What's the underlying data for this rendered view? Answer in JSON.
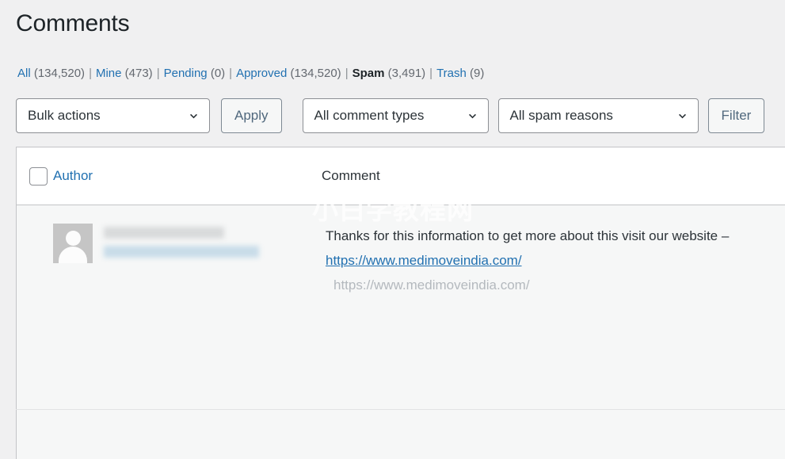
{
  "page": {
    "title": "Comments"
  },
  "filters": {
    "items": [
      {
        "label": "All",
        "count": "(134,520)",
        "current": false
      },
      {
        "label": "Mine",
        "count": "(473)",
        "current": false
      },
      {
        "label": "Pending",
        "count": "(0)",
        "current": false
      },
      {
        "label": "Approved",
        "count": "(134,520)",
        "current": false
      },
      {
        "label": "Spam",
        "count": "(3,491)",
        "current": true
      },
      {
        "label": "Trash",
        "count": "(9)",
        "current": false
      }
    ],
    "separator": "|"
  },
  "toolbar": {
    "bulk_actions_value": "Bulk actions",
    "apply_label": "Apply",
    "comment_types_value": "All comment types",
    "spam_reasons_value": "All spam reasons",
    "filter_label": "Filter"
  },
  "table": {
    "columns": {
      "author": "Author",
      "comment": "Comment"
    },
    "rows": [
      {
        "author_name_redacted": true,
        "author_email_redacted": true,
        "comment_text_before_link": "Thanks for this information to get more about this visit our website – ",
        "comment_link_text": "https://www.medimoveindia.com/",
        "comment_author_url": "https://www.medimoveindia.com/"
      }
    ]
  },
  "watermark": {
    "text": "小白学教程网"
  },
  "colors": {
    "page_background": "#f0f0f1",
    "link_blue": "#2271b1",
    "text_dark": "#1d2327",
    "text_muted": "#646970",
    "button_border": "#7e8993",
    "row_background": "#f6f7f7",
    "avatar_gray": "#c5c5c5"
  }
}
